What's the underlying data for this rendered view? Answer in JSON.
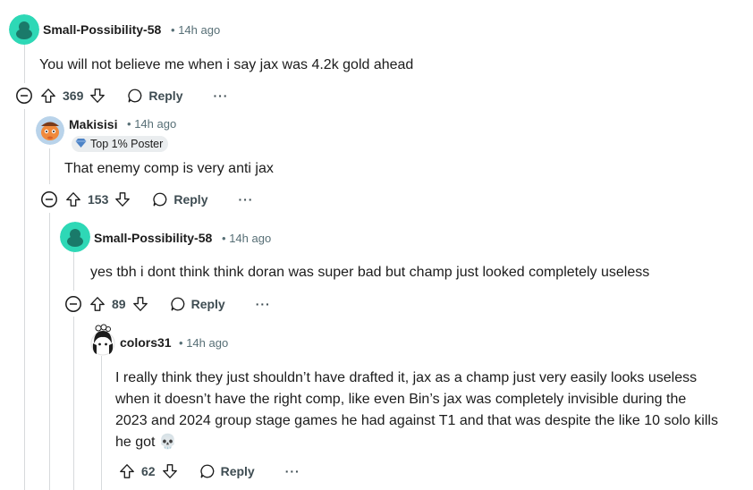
{
  "comments": [
    {
      "username": "Small-Possibility-58",
      "separator": "•",
      "time": "14h ago",
      "text": "You will not believe me when i say jax was 4.2k gold ahead",
      "score": "369",
      "reply_label": "Reply",
      "more_label": "···",
      "avatar_color": "#2ed8b6"
    },
    {
      "username": "Makisisi",
      "separator": "•",
      "time": "14h ago",
      "flair": "Top 1% Poster",
      "text": "That enemy comp is very anti jax",
      "score": "153",
      "reply_label": "Reply",
      "more_label": "···"
    },
    {
      "username": "Small-Possibility-58",
      "separator": "•",
      "time": "14h ago",
      "text": "yes tbh i dont think think doran was super bad but champ just looked completely useless",
      "score": "89",
      "reply_label": "Reply",
      "more_label": "···",
      "avatar_color": "#2ed8b6"
    },
    {
      "username": "colors31",
      "separator": "•",
      "time": "14h ago",
      "text_lines": [
        "I really think they just shouldn’t have drafted it, jax as a champ just very easily looks useless",
        "when it doesn’t have the right comp, like even Bin’s jax was completely invisible during the",
        "2023 and 2024 group stage games he had against T1 and that was despite the like 10 solo kills",
        "he got 💀"
      ],
      "score": "62",
      "reply_label": "Reply",
      "more_label": "···"
    }
  ]
}
